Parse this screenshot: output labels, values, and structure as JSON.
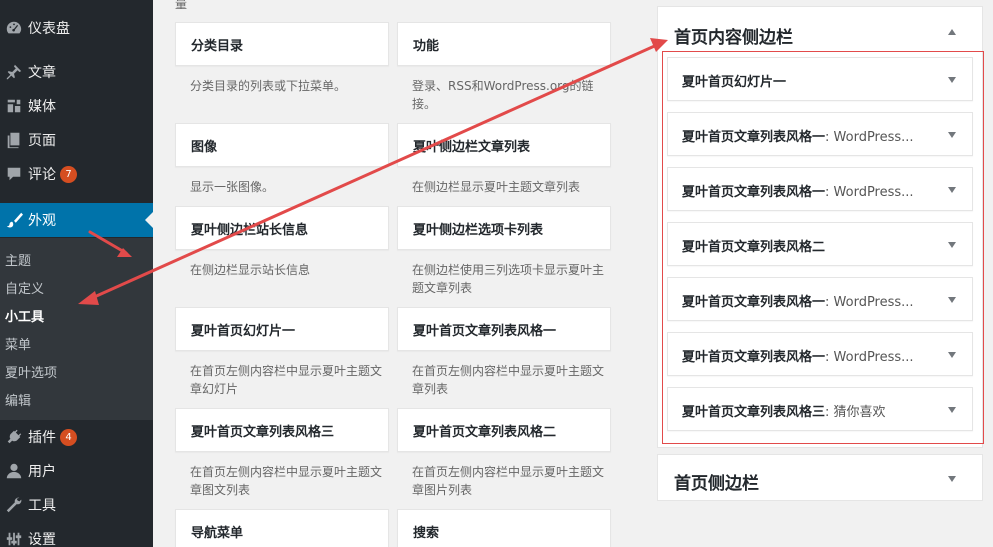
{
  "sidebar": {
    "items": [
      {
        "label": "仪表盘",
        "icon": "dashboard-icon"
      },
      {
        "label": "文章",
        "icon": "pin-icon"
      },
      {
        "label": "媒体",
        "icon": "media-icon"
      },
      {
        "label": "页面",
        "icon": "page-icon"
      },
      {
        "label": "评论",
        "icon": "comment-icon",
        "badge": "7"
      },
      {
        "label": "外观",
        "icon": "brush-icon"
      },
      {
        "label": "插件",
        "icon": "plugin-icon",
        "badge": "4"
      },
      {
        "label": "用户",
        "icon": "user-icon"
      },
      {
        "label": "工具",
        "icon": "wrench-icon"
      },
      {
        "label": "设置",
        "icon": "settings-icon"
      }
    ],
    "submenu": [
      "主题",
      "自定义",
      "小工具",
      "菜单",
      "夏叶选项",
      "编辑"
    ],
    "current_sub": "小工具"
  },
  "available": {
    "top_fragment": "量",
    "widgets": [
      {
        "title": "分类目录",
        "desc": "分类目录的列表或下拉菜单。"
      },
      {
        "title": "功能",
        "desc": "登录、RSS和WordPress.org的链接。"
      },
      {
        "title": "图像",
        "desc": "显示一张图像。"
      },
      {
        "title": "夏叶侧边栏文章列表",
        "desc": "在侧边栏显示夏叶主题文章列表"
      },
      {
        "title": "夏叶侧边栏站长信息",
        "desc": "在侧边栏显示站长信息"
      },
      {
        "title": "夏叶侧边栏选项卡列表",
        "desc": "在侧边栏使用三列选项卡显示夏叶主题文章列表"
      },
      {
        "title": "夏叶首页幻灯片一",
        "desc": "在首页左侧内容栏中显示夏叶主题文章幻灯片"
      },
      {
        "title": "夏叶首页文章列表风格一",
        "desc": "在首页左侧内容栏中显示夏叶主题文章列表"
      },
      {
        "title": "夏叶首页文章列表风格三",
        "desc": "在首页左侧内容栏中显示夏叶主题文章图文列表"
      },
      {
        "title": "夏叶首页文章列表风格二",
        "desc": "在首页左侧内容栏中显示夏叶主题文章图片列表"
      },
      {
        "title": "导航菜单",
        "desc": ""
      },
      {
        "title": "搜索",
        "desc": ""
      }
    ]
  },
  "home_content_sidebar": {
    "title": "首页内容侧边栏",
    "widgets": [
      {
        "title": "夏叶首页幻灯片一",
        "sub": ""
      },
      {
        "title": "夏叶首页文章列表风格一",
        "sub": ": WordPress..."
      },
      {
        "title": "夏叶首页文章列表风格一",
        "sub": ": WordPress..."
      },
      {
        "title": "夏叶首页文章列表风格二",
        "sub": ""
      },
      {
        "title": "夏叶首页文章列表风格一",
        "sub": ": WordPress..."
      },
      {
        "title": "夏叶首页文章列表风格一",
        "sub": ": WordPress..."
      },
      {
        "title": "夏叶首页文章列表风格三",
        "sub": ": 猜你喜欢"
      }
    ]
  },
  "home_sidebar": {
    "title": "首页侧边栏"
  },
  "colors": {
    "admin_bar": "#23282d",
    "active": "#0073aa",
    "badge": "#d54e21",
    "annotation": "#e24a4a"
  }
}
